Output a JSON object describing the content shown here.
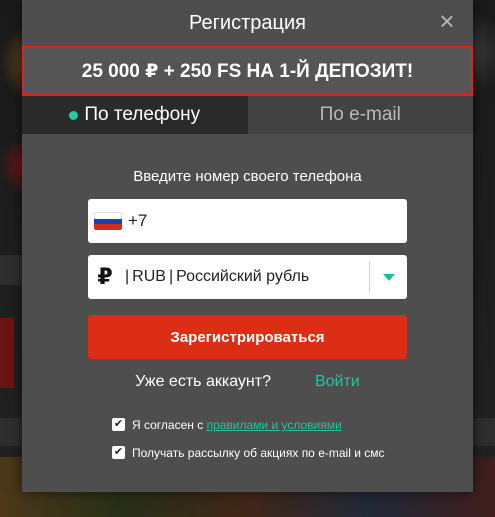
{
  "modal": {
    "title": "Регистрация",
    "close_icon": "×"
  },
  "promo": {
    "text": "25 000 ₽ + 250 FS НА 1-Й ДЕПОЗИТ!"
  },
  "tabs": [
    {
      "label": "По телефону",
      "active": true
    },
    {
      "label": "По e-mail",
      "active": false
    }
  ],
  "form": {
    "prompt": "Введите номер своего телефона",
    "phone_value": "+7",
    "currency_icon": "₽",
    "currency_code": "RUB",
    "currency_name": "Российский рубль",
    "register_label": "Зарегистрироваться",
    "has_account": "Уже есть аккаунт?",
    "login_label": "Войти"
  },
  "consents": {
    "terms_prefix": "Я согласен с ",
    "terms_link": "правилами и условиями",
    "newsletter": "Получать рассылку об акциях по e-mail и смс"
  },
  "colors": {
    "accent": "#29c2a0",
    "primary_button": "#dc2e14",
    "promo_border": "#d9261c",
    "modal_bg": "#4e4e4e"
  }
}
